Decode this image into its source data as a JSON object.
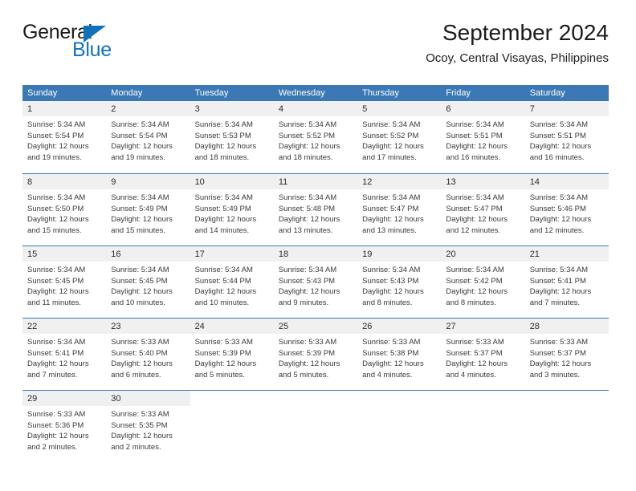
{
  "logo": {
    "word1": "General",
    "word2": "Blue",
    "triangle_color": "#1172ba",
    "icon": "triangle-icon"
  },
  "header": {
    "title": "September 2024",
    "subtitle": "Ocoy, Central Visayas, Philippines"
  },
  "theme": {
    "header_blue": "#3b78b5",
    "daynum_band": "#f0f0f0",
    "text": "#3a3a3a",
    "accent_blue": "#1172ba"
  },
  "calendar": {
    "weekday_headers": [
      "Sunday",
      "Monday",
      "Tuesday",
      "Wednesday",
      "Thursday",
      "Friday",
      "Saturday"
    ],
    "weeks": [
      [
        {
          "day": "1",
          "sunrise": "Sunrise: 5:34 AM",
          "sunset": "Sunset: 5:54 PM",
          "daylight1": "Daylight: 12 hours",
          "daylight2": "and 19 minutes."
        },
        {
          "day": "2",
          "sunrise": "Sunrise: 5:34 AM",
          "sunset": "Sunset: 5:54 PM",
          "daylight1": "Daylight: 12 hours",
          "daylight2": "and 19 minutes."
        },
        {
          "day": "3",
          "sunrise": "Sunrise: 5:34 AM",
          "sunset": "Sunset: 5:53 PM",
          "daylight1": "Daylight: 12 hours",
          "daylight2": "and 18 minutes."
        },
        {
          "day": "4",
          "sunrise": "Sunrise: 5:34 AM",
          "sunset": "Sunset: 5:52 PM",
          "daylight1": "Daylight: 12 hours",
          "daylight2": "and 18 minutes."
        },
        {
          "day": "5",
          "sunrise": "Sunrise: 5:34 AM",
          "sunset": "Sunset: 5:52 PM",
          "daylight1": "Daylight: 12 hours",
          "daylight2": "and 17 minutes."
        },
        {
          "day": "6",
          "sunrise": "Sunrise: 5:34 AM",
          "sunset": "Sunset: 5:51 PM",
          "daylight1": "Daylight: 12 hours",
          "daylight2": "and 16 minutes."
        },
        {
          "day": "7",
          "sunrise": "Sunrise: 5:34 AM",
          "sunset": "Sunset: 5:51 PM",
          "daylight1": "Daylight: 12 hours",
          "daylight2": "and 16 minutes."
        }
      ],
      [
        {
          "day": "8",
          "sunrise": "Sunrise: 5:34 AM",
          "sunset": "Sunset: 5:50 PM",
          "daylight1": "Daylight: 12 hours",
          "daylight2": "and 15 minutes."
        },
        {
          "day": "9",
          "sunrise": "Sunrise: 5:34 AM",
          "sunset": "Sunset: 5:49 PM",
          "daylight1": "Daylight: 12 hours",
          "daylight2": "and 15 minutes."
        },
        {
          "day": "10",
          "sunrise": "Sunrise: 5:34 AM",
          "sunset": "Sunset: 5:49 PM",
          "daylight1": "Daylight: 12 hours",
          "daylight2": "and 14 minutes."
        },
        {
          "day": "11",
          "sunrise": "Sunrise: 5:34 AM",
          "sunset": "Sunset: 5:48 PM",
          "daylight1": "Daylight: 12 hours",
          "daylight2": "and 13 minutes."
        },
        {
          "day": "12",
          "sunrise": "Sunrise: 5:34 AM",
          "sunset": "Sunset: 5:47 PM",
          "daylight1": "Daylight: 12 hours",
          "daylight2": "and 13 minutes."
        },
        {
          "day": "13",
          "sunrise": "Sunrise: 5:34 AM",
          "sunset": "Sunset: 5:47 PM",
          "daylight1": "Daylight: 12 hours",
          "daylight2": "and 12 minutes."
        },
        {
          "day": "14",
          "sunrise": "Sunrise: 5:34 AM",
          "sunset": "Sunset: 5:46 PM",
          "daylight1": "Daylight: 12 hours",
          "daylight2": "and 12 minutes."
        }
      ],
      [
        {
          "day": "15",
          "sunrise": "Sunrise: 5:34 AM",
          "sunset": "Sunset: 5:45 PM",
          "daylight1": "Daylight: 12 hours",
          "daylight2": "and 11 minutes."
        },
        {
          "day": "16",
          "sunrise": "Sunrise: 5:34 AM",
          "sunset": "Sunset: 5:45 PM",
          "daylight1": "Daylight: 12 hours",
          "daylight2": "and 10 minutes."
        },
        {
          "day": "17",
          "sunrise": "Sunrise: 5:34 AM",
          "sunset": "Sunset: 5:44 PM",
          "daylight1": "Daylight: 12 hours",
          "daylight2": "and 10 minutes."
        },
        {
          "day": "18",
          "sunrise": "Sunrise: 5:34 AM",
          "sunset": "Sunset: 5:43 PM",
          "daylight1": "Daylight: 12 hours",
          "daylight2": "and 9 minutes."
        },
        {
          "day": "19",
          "sunrise": "Sunrise: 5:34 AM",
          "sunset": "Sunset: 5:43 PM",
          "daylight1": "Daylight: 12 hours",
          "daylight2": "and 8 minutes."
        },
        {
          "day": "20",
          "sunrise": "Sunrise: 5:34 AM",
          "sunset": "Sunset: 5:42 PM",
          "daylight1": "Daylight: 12 hours",
          "daylight2": "and 8 minutes."
        },
        {
          "day": "21",
          "sunrise": "Sunrise: 5:34 AM",
          "sunset": "Sunset: 5:41 PM",
          "daylight1": "Daylight: 12 hours",
          "daylight2": "and 7 minutes."
        }
      ],
      [
        {
          "day": "22",
          "sunrise": "Sunrise: 5:34 AM",
          "sunset": "Sunset: 5:41 PM",
          "daylight1": "Daylight: 12 hours",
          "daylight2": "and 7 minutes."
        },
        {
          "day": "23",
          "sunrise": "Sunrise: 5:33 AM",
          "sunset": "Sunset: 5:40 PM",
          "daylight1": "Daylight: 12 hours",
          "daylight2": "and 6 minutes."
        },
        {
          "day": "24",
          "sunrise": "Sunrise: 5:33 AM",
          "sunset": "Sunset: 5:39 PM",
          "daylight1": "Daylight: 12 hours",
          "daylight2": "and 5 minutes."
        },
        {
          "day": "25",
          "sunrise": "Sunrise: 5:33 AM",
          "sunset": "Sunset: 5:39 PM",
          "daylight1": "Daylight: 12 hours",
          "daylight2": "and 5 minutes."
        },
        {
          "day": "26",
          "sunrise": "Sunrise: 5:33 AM",
          "sunset": "Sunset: 5:38 PM",
          "daylight1": "Daylight: 12 hours",
          "daylight2": "and 4 minutes."
        },
        {
          "day": "27",
          "sunrise": "Sunrise: 5:33 AM",
          "sunset": "Sunset: 5:37 PM",
          "daylight1": "Daylight: 12 hours",
          "daylight2": "and 4 minutes."
        },
        {
          "day": "28",
          "sunrise": "Sunrise: 5:33 AM",
          "sunset": "Sunset: 5:37 PM",
          "daylight1": "Daylight: 12 hours",
          "daylight2": "and 3 minutes."
        }
      ],
      [
        {
          "day": "29",
          "sunrise": "Sunrise: 5:33 AM",
          "sunset": "Sunset: 5:36 PM",
          "daylight1": "Daylight: 12 hours",
          "daylight2": "and 2 minutes."
        },
        {
          "day": "30",
          "sunrise": "Sunrise: 5:33 AM",
          "sunset": "Sunset: 5:35 PM",
          "daylight1": "Daylight: 12 hours",
          "daylight2": "and 2 minutes."
        },
        {
          "day": "",
          "sunrise": "",
          "sunset": "",
          "daylight1": "",
          "daylight2": ""
        },
        {
          "day": "",
          "sunrise": "",
          "sunset": "",
          "daylight1": "",
          "daylight2": ""
        },
        {
          "day": "",
          "sunrise": "",
          "sunset": "",
          "daylight1": "",
          "daylight2": ""
        },
        {
          "day": "",
          "sunrise": "",
          "sunset": "",
          "daylight1": "",
          "daylight2": ""
        },
        {
          "day": "",
          "sunrise": "",
          "sunset": "",
          "daylight1": "",
          "daylight2": ""
        }
      ]
    ]
  }
}
